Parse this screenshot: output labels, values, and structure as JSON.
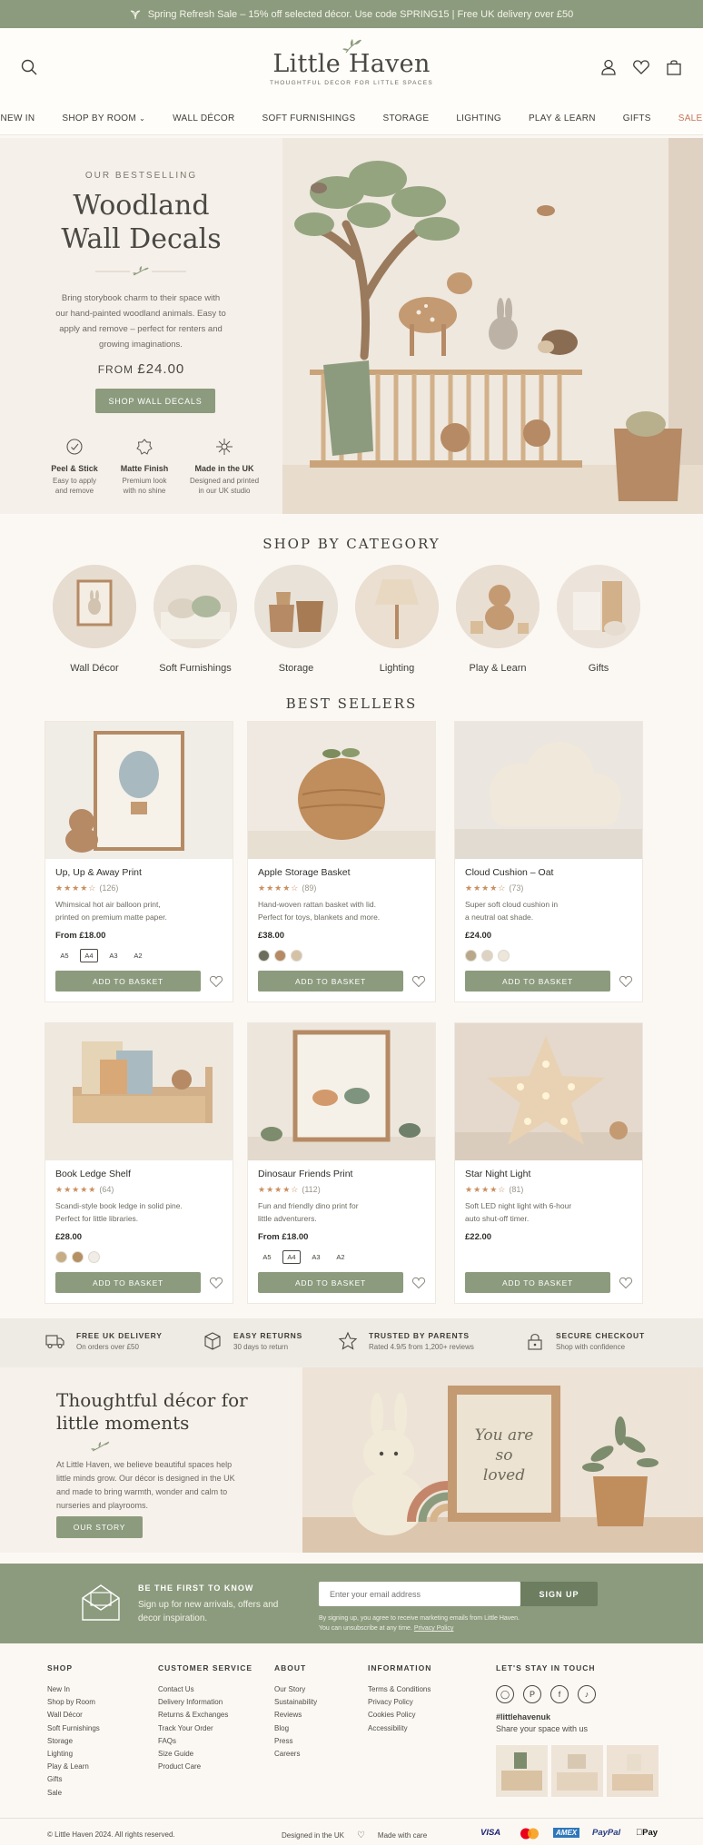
{
  "promo": {
    "text": "Spring Refresh Sale – 15% off selected décor. Use code SPRING15 | Free UK delivery over £50"
  },
  "header": {
    "brand": "Little Haven",
    "tagline": "THOUGHTFUL DECOR FOR LITTLE SPACES",
    "nav": [
      "NEW IN",
      "SHOP BY ROOM",
      "WALL DÉCOR",
      "SOFT FURNISHINGS",
      "STORAGE",
      "LIGHTING",
      "PLAY & LEARN",
      "GIFTS",
      "SALE"
    ]
  },
  "hero": {
    "eyebrow": "OUR BESTSELLING",
    "title_line1": "Woodland",
    "title_line2": "Wall Decals",
    "description": "Bring storybook charm to their space with our hand-painted woodland animals. Easy to apply and remove – perfect for renters and growing imaginations.",
    "price_prefix": "FROM",
    "price": "£24.00",
    "cta": "SHOP WALL DECALS",
    "features": [
      {
        "title": "Peel & Stick",
        "sub1": "Easy to apply",
        "sub2": "and remove"
      },
      {
        "title": "Matte Finish",
        "sub1": "Premium look",
        "sub2": "with no shine"
      },
      {
        "title": "Made in the UK",
        "sub1": "Designed and printed",
        "sub2": "in our UK studio"
      }
    ]
  },
  "categories": {
    "title": "SHOP BY CATEGORY",
    "items": [
      "Wall Décor",
      "Soft Furnishings",
      "Storage",
      "Lighting",
      "Play & Learn",
      "Gifts"
    ]
  },
  "bestsellers": {
    "title": "BEST SELLERS",
    "add_label": "ADD TO BASKET",
    "products": [
      {
        "name": "Up, Up & Away Print",
        "stars": "★★★★☆",
        "reviews": "(126)",
        "desc1": "Whimsical hot air balloon print,",
        "desc2": "printed on premium matte paper.",
        "price": "From £18.00",
        "sizes": [
          "A5",
          "A4",
          "A3",
          "A2"
        ]
      },
      {
        "name": "Apple Storage Basket",
        "stars": "★★★★☆",
        "reviews": "(89)",
        "desc1": "Hand-woven rattan basket with lid.",
        "desc2": "Perfect for toys, blankets and more.",
        "price": "£38.00",
        "swatches": [
          "#6b6e5c",
          "#b58a64",
          "#d5c2a6"
        ]
      },
      {
        "name": "Cloud Cushion – Oat",
        "stars": "★★★★☆",
        "reviews": "(73)",
        "desc1": "Super soft cloud cushion in",
        "desc2": "a neutral oat shade.",
        "price": "£24.00",
        "swatches": [
          "#b9a78a",
          "#ddd3c3",
          "#ece6db"
        ]
      },
      {
        "name": "Book Ledge Shelf",
        "stars": "★★★★★",
        "reviews": "(64)",
        "desc1": "Scandi-style book ledge in solid pine.",
        "desc2": "Perfect for little libraries.",
        "price": "£28.00",
        "swatches": [
          "#c6ad86",
          "#b59064",
          "#f1ede6"
        ]
      },
      {
        "name": "Dinosaur Friends Print",
        "stars": "★★★★☆",
        "reviews": "(112)",
        "desc1": "Fun and friendly dino print for",
        "desc2": "little adventurers.",
        "price": "From £18.00",
        "sizes": [
          "A5",
          "A4",
          "A3",
          "A2"
        ]
      },
      {
        "name": "Star Night Light",
        "stars": "★★★★☆",
        "reviews": "(81)",
        "desc1": "Soft LED night light with 6-hour",
        "desc2": "auto shut-off timer.",
        "price": "£22.00"
      }
    ]
  },
  "usps": [
    {
      "title": "FREE UK DELIVERY",
      "sub": "On orders over £50"
    },
    {
      "title": "EASY RETURNS",
      "sub": "30 days to return"
    },
    {
      "title": "TRUSTED BY PARENTS",
      "sub": "Rated 4.9/5 from 1,200+ reviews"
    },
    {
      "title": "SECURE CHECKOUT",
      "sub": "Shop with confidence"
    }
  ],
  "story": {
    "title_line1": "Thoughtful décor for",
    "title_line2": "little moments",
    "description": "At Little Haven, we believe beautiful spaces help little minds grow. Our décor is designed in the UK and made to bring warmth, wonder and calm to nurseries and playrooms.",
    "cta": "OUR STORY",
    "print_line1": "You are",
    "print_line2": "so",
    "print_line3": "loved"
  },
  "newsletter": {
    "title": "BE THE FIRST TO KNOW",
    "subtitle": "Sign up for new arrivals, offers and decor inspiration.",
    "placeholder": "Enter your email address",
    "button": "SIGN UP",
    "legal1": "By signing up, you agree to receive marketing emails from Little Haven.",
    "legal2": "You can unsubscribe at any time.",
    "legal_link": "Privacy Policy"
  },
  "footer": {
    "shop": {
      "title": "SHOP",
      "links": [
        "New In",
        "Shop by Room",
        "Wall Décor",
        "Soft Furnishings",
        "Storage",
        "Lighting",
        "Play & Learn",
        "Gifts",
        "Sale"
      ]
    },
    "service": {
      "title": "CUSTOMER SERVICE",
      "links": [
        "Contact Us",
        "Delivery Information",
        "Returns & Exchanges",
        "Track Your Order",
        "FAQs",
        "Size Guide",
        "Product Care"
      ]
    },
    "about": {
      "title": "ABOUT",
      "links": [
        "Our Story",
        "Sustainability",
        "Reviews",
        "Blog",
        "Press",
        "Careers"
      ]
    },
    "info": {
      "title": "INFORMATION",
      "links": [
        "Terms & Conditions",
        "Privacy Policy",
        "Cookies Policy",
        "Accessibility"
      ]
    },
    "touch": {
      "title": "LET'S STAY IN TOUCH",
      "hashtag": "#littlehavenuk",
      "share": "Share your space with us"
    },
    "copyright": "© Little Haven 2024. All rights reserved.",
    "designed": "Designed in the UK",
    "made": "Made with care",
    "payments": [
      "VISA",
      "AMEX",
      "PayPal",
      "Pay"
    ]
  }
}
